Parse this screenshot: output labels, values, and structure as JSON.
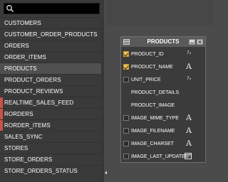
{
  "search": {
    "value": "",
    "placeholder": ""
  },
  "tables": [
    {
      "name": "CUSTOMERS",
      "marked": false,
      "selected": false
    },
    {
      "name": "CUSTOMER_ORDER_PRODUCTS",
      "marked": false,
      "selected": false
    },
    {
      "name": "ORDERS",
      "marked": false,
      "selected": false
    },
    {
      "name": "ORDER_ITEMS",
      "marked": false,
      "selected": false
    },
    {
      "name": "PRODUCTS",
      "marked": false,
      "selected": true
    },
    {
      "name": "PRODUCT_ORDERS",
      "marked": false,
      "selected": false
    },
    {
      "name": "PRODUCT_REVIEWS",
      "marked": false,
      "selected": false
    },
    {
      "name": "REALTIME_SALES_FEED",
      "marked": true,
      "selected": false
    },
    {
      "name": "RORDERS",
      "marked": true,
      "selected": false
    },
    {
      "name": "RORDER_ITEMS",
      "marked": true,
      "selected": false
    },
    {
      "name": "SALES_SYNC",
      "marked": false,
      "selected": false
    },
    {
      "name": "STORES",
      "marked": false,
      "selected": false
    },
    {
      "name": "STORE_ORDERS",
      "marked": false,
      "selected": false
    },
    {
      "name": "STORE_ORDERS_STATUS",
      "marked": false,
      "selected": false
    }
  ],
  "entity": {
    "title": "PRODUCTS",
    "columns": [
      {
        "name": "PRODUCT_ID",
        "checked": true,
        "type": "number",
        "type_label": "7₉"
      },
      {
        "name": "PRODUCT_NAME",
        "checked": true,
        "type": "text",
        "type_label": "A"
      },
      {
        "name": "UNIT_PRICE",
        "checked": false,
        "type": "number",
        "type_label": "7₉"
      },
      {
        "name": "PRODUCT_DETAILS",
        "checked": null,
        "type": "none",
        "type_label": ""
      },
      {
        "name": "PRODUCT_IMAGE",
        "checked": null,
        "type": "none",
        "type_label": ""
      },
      {
        "name": "IMAGE_MIME_TYPE",
        "checked": false,
        "type": "text",
        "type_label": "A"
      },
      {
        "name": "IMAGE_FILENAME",
        "checked": false,
        "type": "text",
        "type_label": "A"
      },
      {
        "name": "IMAGE_CHARSET",
        "checked": false,
        "type": "text",
        "type_label": "A"
      },
      {
        "name": "IMAGE_LAST_UPDATED",
        "checked": false,
        "type": "date",
        "type_label": ""
      }
    ]
  },
  "colors": {
    "marker": "#c9534b",
    "checkbox_checked": "#e7c25a"
  }
}
